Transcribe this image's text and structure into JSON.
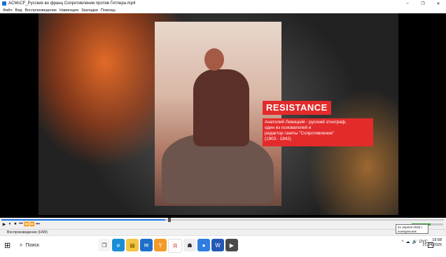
{
  "window": {
    "title": "ACMsCF_Русские во франц Сопротивлении против Гитлера.mp4",
    "controls": [
      "–",
      "❐",
      "✕"
    ]
  },
  "menu": [
    "Файл",
    "Вид",
    "Воспроизведение",
    "Навигация",
    "Закладки",
    "Помощь"
  ],
  "video": {
    "headline": "RESISTANCE",
    "caption_lines": [
      "Анатолий Левицкий - русский этнограф,",
      "один из основателей и",
      "редактор газеты \"Сопротивление\"",
      "(1903 - 1942)"
    ]
  },
  "playback": {
    "progress_fraction": 0.37,
    "volume_fraction": 0.6,
    "buttons": [
      "▶",
      "⏸",
      "⏹",
      "⏮",
      "⏪",
      "⏩",
      "⏭"
    ]
  },
  "status": {
    "text": "Воспроизведение (H/W)",
    "tooltip": "21 апреля 2025 г. понедельник"
  },
  "taskbar": {
    "search_placeholder": "Поиск",
    "icons": [
      "task-view-icon",
      "edge-icon",
      "explorer-icon",
      "mail-icon",
      "yandex-browser-icon",
      "yandex-icon",
      "app-icon",
      "chat-icon",
      "word-icon",
      "player-icon"
    ],
    "tray": [
      "^",
      "☁",
      "🔊",
      "РУС"
    ],
    "time": "19:58",
    "date": "21.04.2025"
  },
  "colors": {
    "accent_red": "#e32b2b",
    "seek_blue": "#1a73e8"
  }
}
